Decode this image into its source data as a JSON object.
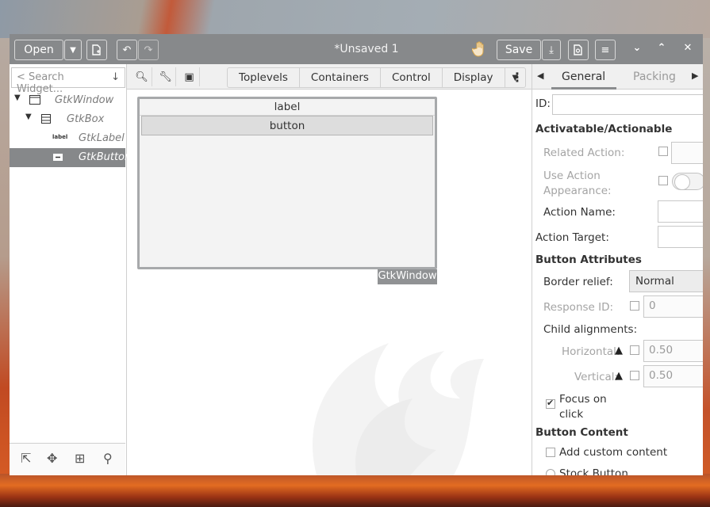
{
  "window": {
    "title": "*Unsaved 1",
    "open_label": "Open",
    "save_label": "Save"
  },
  "palette": {
    "search_placeholder": "< Search Widget...",
    "tree": [
      {
        "label": "GtkWindow",
        "expanded": true
      },
      {
        "label": "GtkBox",
        "expanded": true
      },
      {
        "label": "GtkLabel",
        "icon_text": "label"
      },
      {
        "label": "GtkButton",
        "selected": true
      }
    ]
  },
  "toolbar": {
    "categories": [
      "Toplevels",
      "Containers",
      "Control",
      "Display"
    ]
  },
  "canvas": {
    "label_text": "label",
    "button_text": "button",
    "window_badge": "GtkWindow"
  },
  "properties": {
    "tabs": {
      "general": "General",
      "packing": "Packing"
    },
    "id_label": "ID:",
    "section_activatable": "Activatable/Actionable",
    "related_action": "Related Action:",
    "use_action_appearance": "Use Action\nAppearance:",
    "action_name": "Action Name:",
    "action_target": "Action Target:",
    "section_button_attributes": "Button Attributes",
    "border_relief": "Border relief:",
    "border_relief_value": "Normal",
    "response_id": "Response ID:",
    "response_id_value": "0",
    "child_alignments": "Child alignments:",
    "horizontal": "Horizontal:",
    "horizontal_value": "0.50",
    "vertical": "Vertical:",
    "vertical_value": "0.50",
    "focus_on_click": "Focus on\nclick",
    "section_button_content": "Button Content",
    "add_custom_content": "Add custom content",
    "stock_button": "Stock Button"
  },
  "colors": {
    "titlebar": "#87898b",
    "selection": "#86888a"
  }
}
